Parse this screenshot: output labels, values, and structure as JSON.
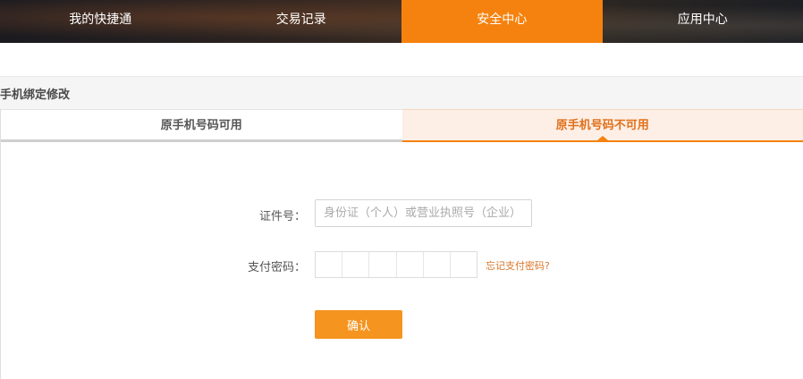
{
  "topnav": {
    "items": [
      {
        "label": "我的快捷通"
      },
      {
        "label": "交易记录"
      },
      {
        "label": "安全中心"
      },
      {
        "label": "应用中心"
      }
    ]
  },
  "section": {
    "title": "手机绑定修改"
  },
  "tabs": [
    {
      "label": "原手机号码可用"
    },
    {
      "label": "原手机号码不可用"
    }
  ],
  "form": {
    "id_label": "证件号：",
    "id_placeholder": "身份证（个人）或营业执照号（企业）",
    "id_value": "",
    "pwd_label": "支付密码：",
    "forgot_link": "忘记支付密码?",
    "confirm_label": "确认"
  },
  "colors": {
    "accent": "#f5820e",
    "button": "#f5941f",
    "link": "#d9762a"
  }
}
